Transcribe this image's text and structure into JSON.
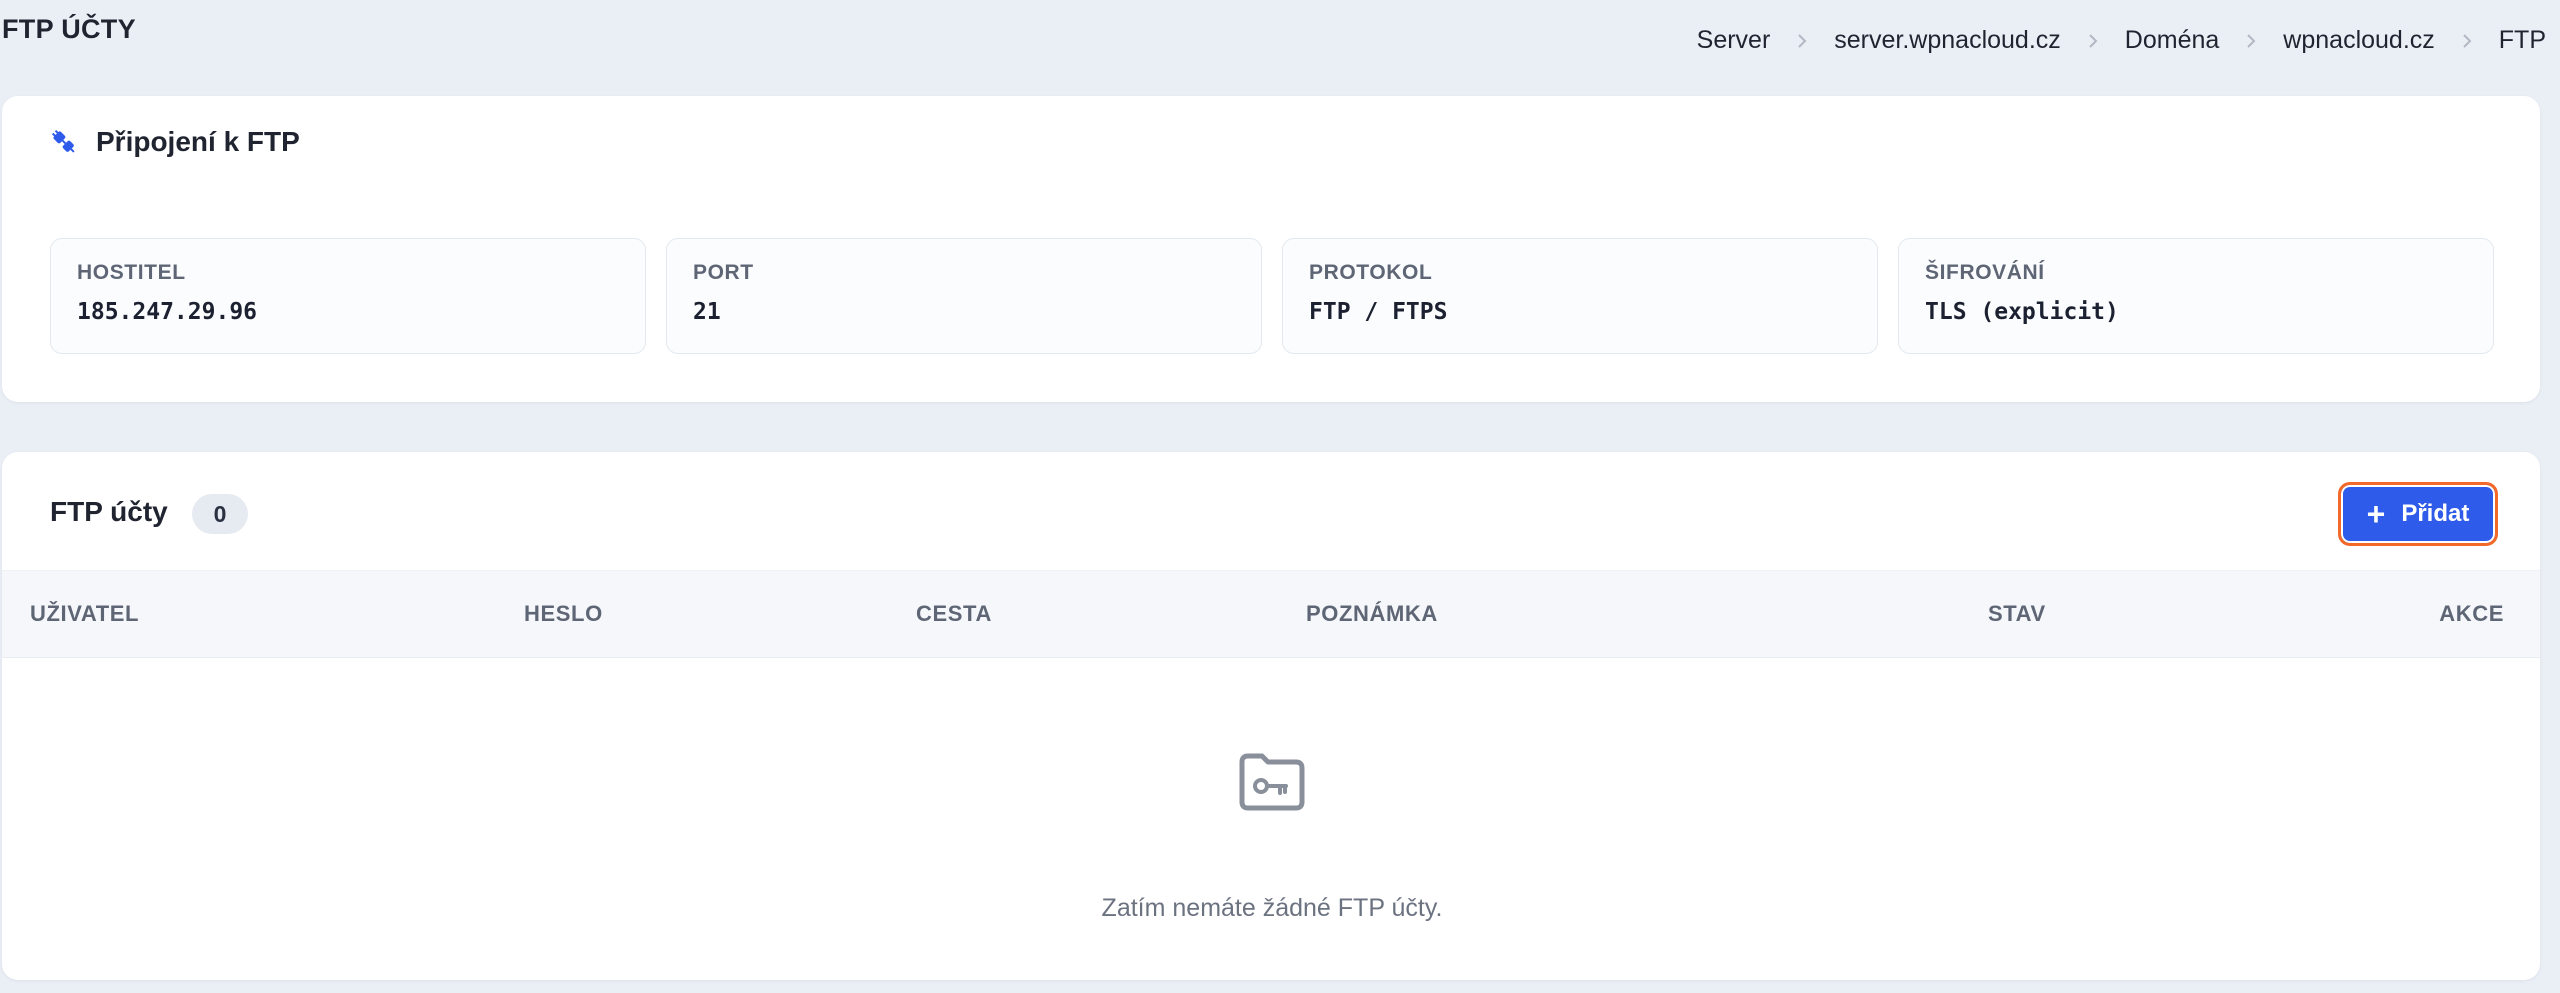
{
  "page": {
    "title": "FTP ÚČTY"
  },
  "breadcrumb": [
    "Server",
    "server.wpnacloud.cz",
    "Doména",
    "wpnacloud.cz",
    "FTP"
  ],
  "connection": {
    "title": "Připojení k FTP",
    "icon": "plug-icon",
    "fields": [
      {
        "label": "HOSTITEL",
        "value": "185.247.29.96"
      },
      {
        "label": "PORT",
        "value": "21"
      },
      {
        "label": "PROTOKOL",
        "value": "FTP / FTPS"
      },
      {
        "label": "ŠIFROVÁNÍ",
        "value": "TLS (explicit)"
      }
    ]
  },
  "accounts": {
    "title": "FTP účty",
    "count": "0",
    "add_label": "Přidat",
    "columns": [
      "UŽIVATEL",
      "HESLO",
      "CESTA",
      "POZNÁMKA",
      "STAV",
      "AKCE"
    ],
    "rows": [],
    "empty_text": "Zatím nemáte žádné FTP účty.",
    "empty_icon": "folder-key-icon"
  },
  "colors": {
    "accent": "#2f5bea",
    "highlight": "#f2692a",
    "background": "#eaeef5"
  }
}
